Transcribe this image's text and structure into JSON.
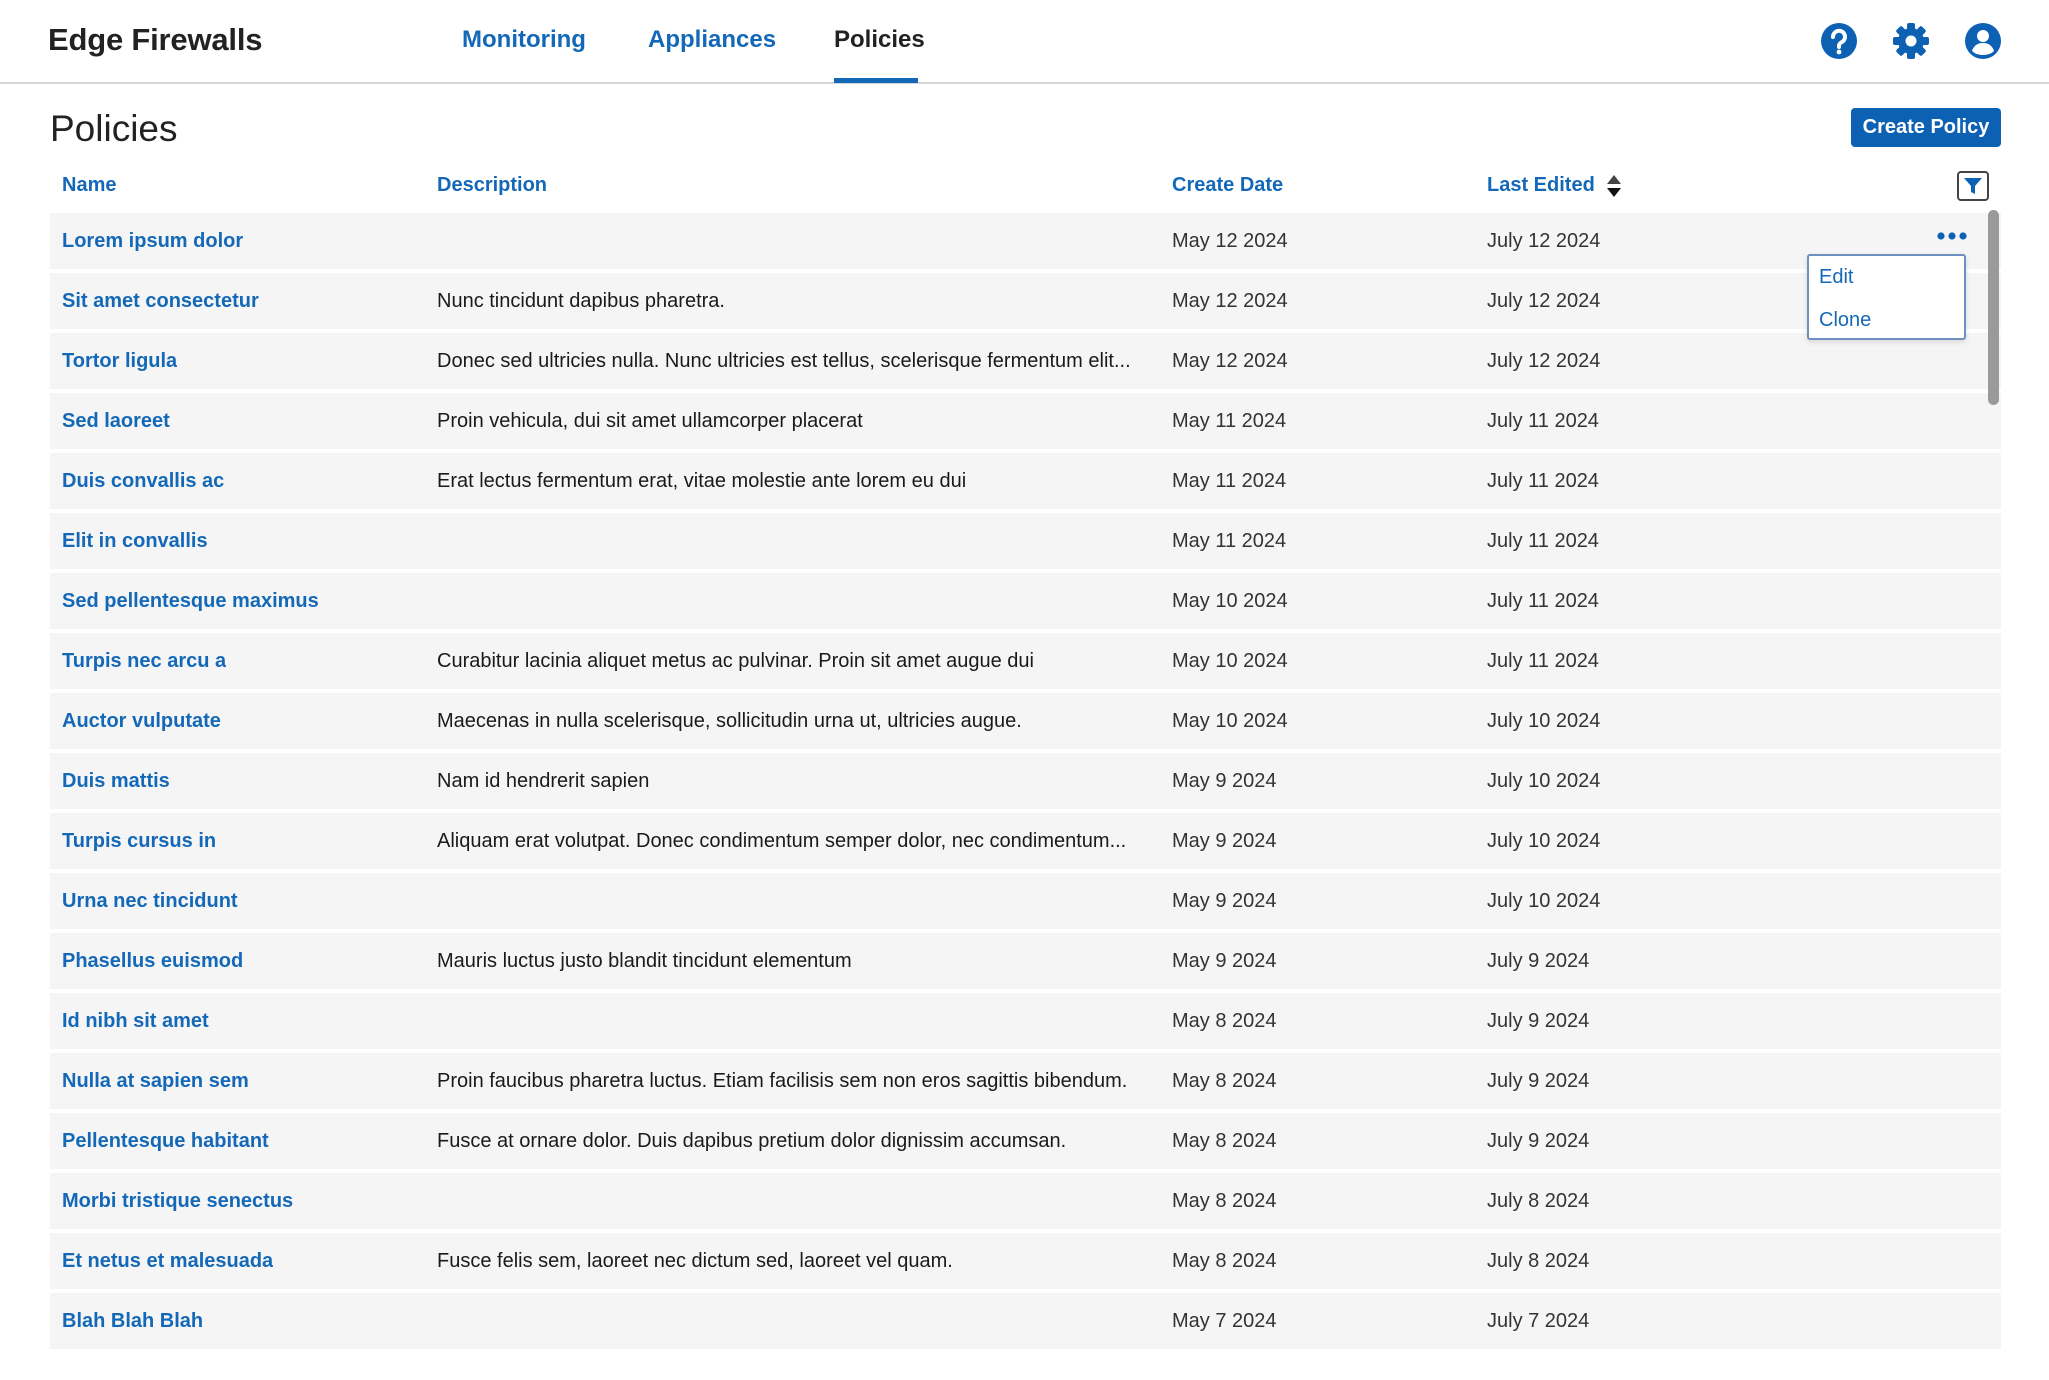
{
  "app": {
    "title": "Edge Firewalls"
  },
  "nav": {
    "tabs": [
      {
        "label": "Monitoring"
      },
      {
        "label": "Appliances"
      },
      {
        "label": "Policies"
      }
    ],
    "active_tab": "Policies"
  },
  "header_icons": [
    "help-icon",
    "gear-icon",
    "user-icon"
  ],
  "page": {
    "title": "Policies",
    "create_button": "Create Policy"
  },
  "table": {
    "columns": {
      "name": "Name",
      "description": "Description",
      "create_date": "Create Date",
      "last_edited": "Last Edited"
    },
    "sorted_by": "Last Edited",
    "rows": [
      {
        "name": "Lorem ipsum dolor",
        "description": "",
        "create_date": "May 12 2024",
        "last_edited": "July 12 2024"
      },
      {
        "name": "Sit amet consectetur",
        "description": "Nunc tincidunt dapibus pharetra.",
        "create_date": "May 12 2024",
        "last_edited": "July 12 2024"
      },
      {
        "name": "Tortor ligula",
        "description": "Donec sed ultricies nulla. Nunc ultricies est tellus, scelerisque fermentum elit...",
        "create_date": "May 12 2024",
        "last_edited": "July 12 2024"
      },
      {
        "name": "Sed laoreet",
        "description": "Proin vehicula, dui sit amet ullamcorper placerat",
        "create_date": "May 11 2024",
        "last_edited": "July 11 2024"
      },
      {
        "name": "Duis convallis ac",
        "description": "Erat lectus fermentum erat, vitae molestie ante lorem eu dui",
        "create_date": "May 11 2024",
        "last_edited": "July 11 2024"
      },
      {
        "name": "Elit in  convallis",
        "description": "",
        "create_date": "May 11 2024",
        "last_edited": "July 11 2024"
      },
      {
        "name": "Sed pellentesque maximus",
        "description": "",
        "create_date": "May 10 2024",
        "last_edited": "July 11 2024"
      },
      {
        "name": "Turpis nec arcu a",
        "description": "Curabitur lacinia aliquet metus ac pulvinar. Proin sit amet augue dui",
        "create_date": "May 10 2024",
        "last_edited": "July 11 2024"
      },
      {
        "name": "Auctor vulputate",
        "description": "Maecenas in nulla scelerisque, sollicitudin urna ut, ultricies augue.",
        "create_date": "May 10 2024",
        "last_edited": "July 10 2024"
      },
      {
        "name": "Duis mattis",
        "description": "Nam id hendrerit sapien",
        "create_date": "May 9 2024",
        "last_edited": "July 10 2024"
      },
      {
        "name": "Turpis cursus in",
        "description": "Aliquam erat volutpat. Donec condimentum semper dolor, nec condimentum...",
        "create_date": "May 9 2024",
        "last_edited": "July 10 2024"
      },
      {
        "name": "Urna nec tincidunt",
        "description": "",
        "create_date": "May 9 2024",
        "last_edited": "July 10 2024"
      },
      {
        "name": "Phasellus euismod",
        "description": "Mauris luctus justo blandit tincidunt elementum",
        "create_date": "May 9 2024",
        "last_edited": "July 9 2024"
      },
      {
        "name": "Id nibh sit amet",
        "description": "",
        "create_date": "May 8 2024",
        "last_edited": "July 9 2024"
      },
      {
        "name": "Nulla at sapien sem",
        "description": "Proin faucibus pharetra luctus. Etiam facilisis sem non eros sagittis bibendum.",
        "create_date": "May 8 2024",
        "last_edited": "July 9 2024"
      },
      {
        "name": "Pellentesque habitant",
        "description": "Fusce at ornare dolor. Duis dapibus pretium dolor dignissim accumsan.",
        "create_date": "May 8 2024",
        "last_edited": "July 9 2024"
      },
      {
        "name": "Morbi tristique senectus",
        "description": "",
        "create_date": "May 8 2024",
        "last_edited": "July 8 2024"
      },
      {
        "name": "Et netus et malesuada",
        "description": "Fusce felis sem, laoreet nec dictum sed, laoreet vel quam.",
        "create_date": "May 8 2024",
        "last_edited": "July 8 2024"
      },
      {
        "name": "Blah Blah Blah",
        "description": "",
        "create_date": "May 7 2024",
        "last_edited": "July 7 2024"
      }
    ]
  },
  "row_menu": {
    "items": [
      {
        "label": "Edit"
      },
      {
        "label": "Clone"
      }
    ]
  },
  "colors": {
    "accent": "#1468b8",
    "button": "#0d61b3",
    "row_bg": "#f5f5f5"
  }
}
